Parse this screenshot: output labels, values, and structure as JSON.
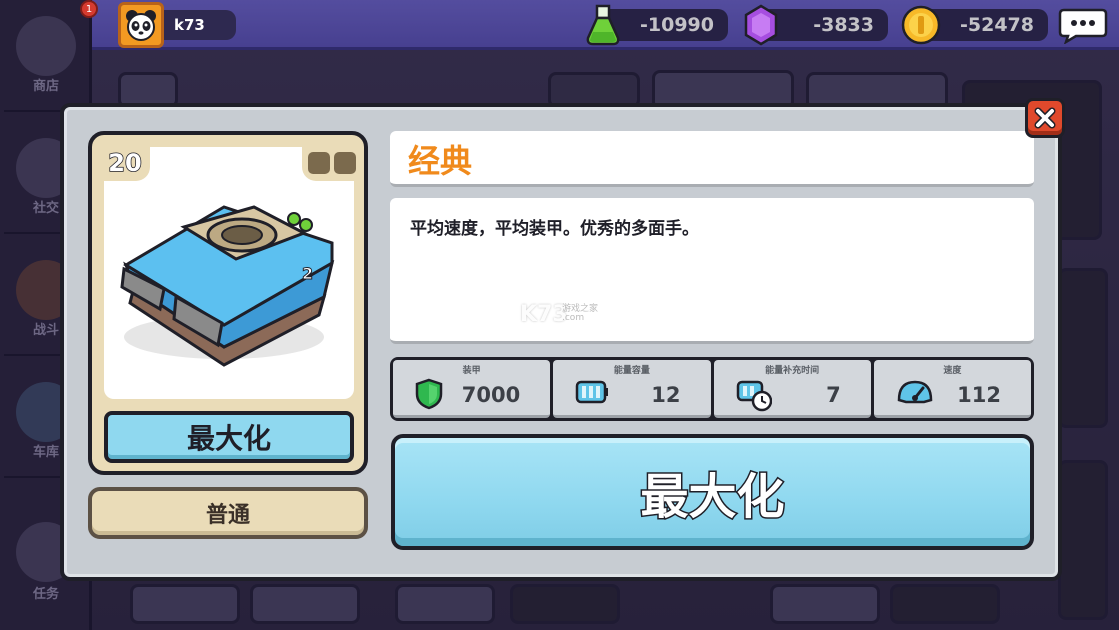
{
  "player": {
    "name": "k73",
    "notification_count": "1"
  },
  "currencies": [
    {
      "name": "potion",
      "icon": "potion-icon",
      "value": "-10990"
    },
    {
      "name": "gem",
      "icon": "gem-icon",
      "value": "-3833"
    },
    {
      "name": "coin",
      "icon": "coin-icon",
      "value": "-52478"
    }
  ],
  "sidebar": {
    "items": [
      {
        "label": "商店",
        "icon": "shop-icon"
      },
      {
        "label": "社交",
        "icon": "walkie-talkie-icon"
      },
      {
        "label": "战斗",
        "icon": "battle-icon"
      },
      {
        "label": "车库",
        "icon": "garage-icon"
      },
      {
        "label": "任务",
        "icon": "clipboard-icon"
      }
    ]
  },
  "modal": {
    "tank": {
      "level": "20",
      "name": "经典",
      "description": "平均速度，平均装甲。优秀的多面手。",
      "rarity": "普通",
      "card_button": "最大化"
    },
    "stats": [
      {
        "label": "装甲",
        "icon": "shield-icon",
        "value": "7000"
      },
      {
        "label": "能量容量",
        "icon": "battery-icon",
        "value": "12"
      },
      {
        "label": "能量补充时间",
        "icon": "battery-timer-icon",
        "value": "7"
      },
      {
        "label": "速度",
        "icon": "speedometer-icon",
        "value": "112"
      }
    ],
    "main_button": "最大化",
    "watermark": "K73",
    "watermark_small": "游戏之家\n.com"
  },
  "colors": {
    "accent_orange": "#f08a1c",
    "button_blue": "#8fd8ef",
    "close_red": "#e0492c",
    "topbar_purple": "#6b63c9"
  }
}
